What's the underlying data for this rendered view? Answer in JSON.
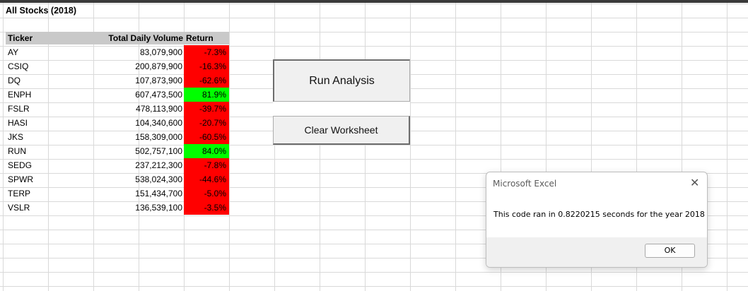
{
  "sheet": {
    "title": "All Stocks (2018)",
    "headers": {
      "ticker": "Ticker",
      "volume": "Total Daily Volume",
      "return": "Return"
    },
    "rows": [
      {
        "ticker": "AY",
        "volume": "83,079,900",
        "return": "-7.3%",
        "status": "negative"
      },
      {
        "ticker": "CSIQ",
        "volume": "200,879,900",
        "return": "-16.3%",
        "status": "negative"
      },
      {
        "ticker": "DQ",
        "volume": "107,873,900",
        "return": "-62.6%",
        "status": "negative"
      },
      {
        "ticker": "ENPH",
        "volume": "607,473,500",
        "return": "81.9%",
        "status": "positive"
      },
      {
        "ticker": "FSLR",
        "volume": "478,113,900",
        "return": "-39.7%",
        "status": "negative"
      },
      {
        "ticker": "HASI",
        "volume": "104,340,600",
        "return": "-20.7%",
        "status": "negative"
      },
      {
        "ticker": "JKS",
        "volume": "158,309,000",
        "return": "-60.5%",
        "status": "negative"
      },
      {
        "ticker": "RUN",
        "volume": "502,757,100",
        "return": "84.0%",
        "status": "positive"
      },
      {
        "ticker": "SEDG",
        "volume": "237,212,300",
        "return": "-7.8%",
        "status": "negative"
      },
      {
        "ticker": "SPWR",
        "volume": "538,024,300",
        "return": "-44.6%",
        "status": "negative"
      },
      {
        "ticker": "TERP",
        "volume": "151,434,700",
        "return": "-5.0%",
        "status": "negative"
      },
      {
        "ticker": "VSLR",
        "volume": "136,539,100",
        "return": "-3.5%",
        "status": "negative"
      }
    ]
  },
  "colors": {
    "positive": "#00ff00",
    "negative": "#ff0000",
    "header": "#c9c9c9"
  },
  "buttons": {
    "run_label": "Run Analysis",
    "clear_label": "Clear Worksheet"
  },
  "dialog": {
    "title": "Microsoft Excel",
    "message": "This code ran in 0.8220215 seconds for the year 2018",
    "ok_label": "OK",
    "close_icon": "close-icon"
  }
}
